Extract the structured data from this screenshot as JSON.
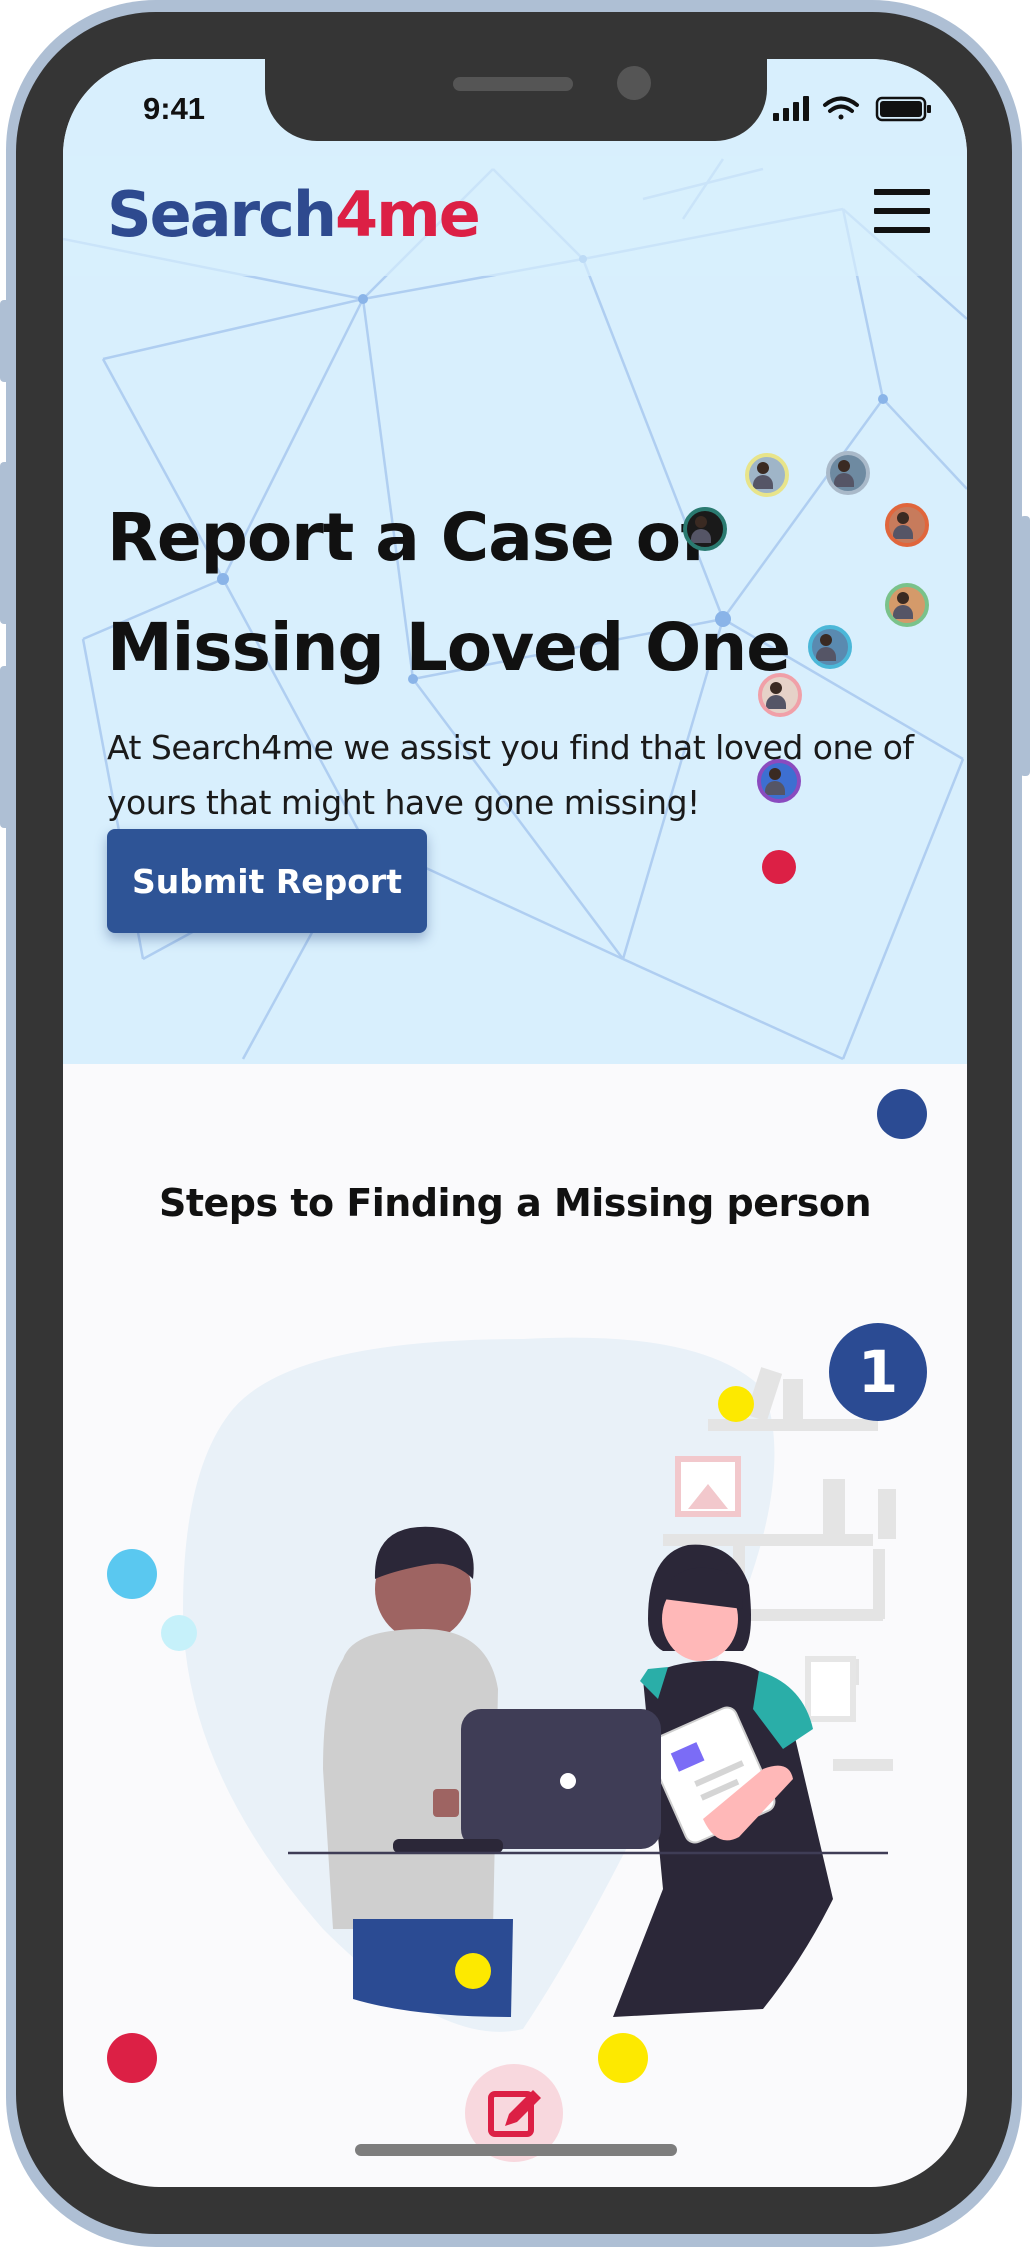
{
  "status_bar": {
    "time": "9:41"
  },
  "header": {
    "logo": {
      "part1": "Search",
      "part2": "4",
      "part3": "me"
    },
    "menu_icon": "hamburger-menu-icon"
  },
  "hero": {
    "title": "Report a Case of Missing Loved One",
    "subtitle": "At Search4me we assist you find that loved one of yours that might have gone missing!",
    "submit_label": "Submit Report"
  },
  "steps": {
    "title": "Steps to Finding a Missing person",
    "step_number": "1",
    "edit_icon": "edit-pencil-icon"
  },
  "colors": {
    "brand_blue": "#2e4a8f",
    "brand_red": "#dc2045",
    "button_blue": "#2e5496",
    "hero_bg": "#d8effd"
  }
}
